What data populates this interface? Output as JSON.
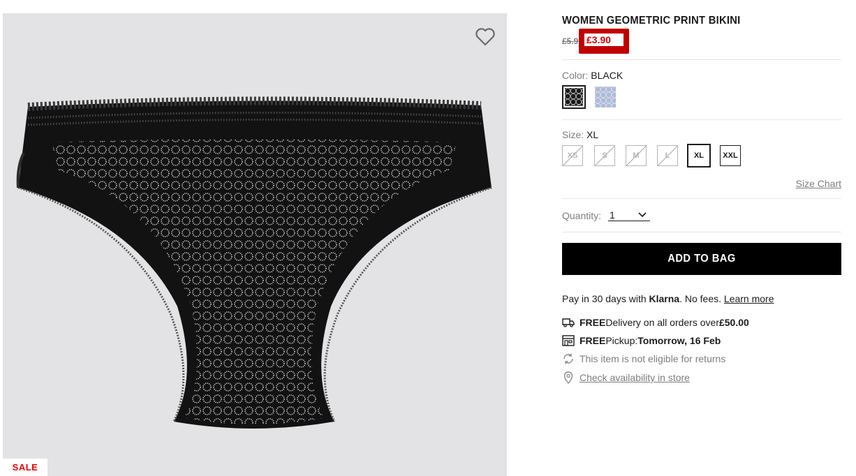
{
  "product": {
    "title": "WOMEN GEOMETRIC PRINT BIKINI",
    "old_price": "£5.9",
    "sale_price": "£3.90",
    "badge": "SALE"
  },
  "color": {
    "label": "Color:",
    "value": "BLACK",
    "options": [
      "black",
      "light-blue"
    ]
  },
  "size": {
    "label": "Size:",
    "value": "XL",
    "options": [
      {
        "label": "XS",
        "state": "unavailable"
      },
      {
        "label": "S",
        "state": "unavailable"
      },
      {
        "label": "M",
        "state": "unavailable"
      },
      {
        "label": "L",
        "state": "unavailable"
      },
      {
        "label": "XL",
        "state": "selected"
      },
      {
        "label": "XXL",
        "state": "available"
      }
    ],
    "chart_link": "Size Chart"
  },
  "quantity": {
    "label": "Quantity:",
    "value": "1"
  },
  "cta": {
    "add_to_bag": "ADD TO BAG"
  },
  "klarna": {
    "prefix": "Pay in 30 days with ",
    "brand": "Klarna",
    "suffix": ". No fees. ",
    "link": "Learn more"
  },
  "features": {
    "delivery": {
      "bold": "FREE",
      "text": " Delivery on all orders over ",
      "amount": "£50.00"
    },
    "pickup": {
      "bold": "FREE",
      "text": " Pickup: ",
      "when": "Tomorrow, 16 Feb"
    },
    "returns": {
      "text": "This item is not eligible for returns"
    },
    "store": {
      "link": "Check availability in store"
    }
  },
  "colors": {
    "highlight": "#c00000",
    "sale_red": "#e00000",
    "button_bg": "#000000",
    "gallery_bg": "#e3e3e6"
  }
}
